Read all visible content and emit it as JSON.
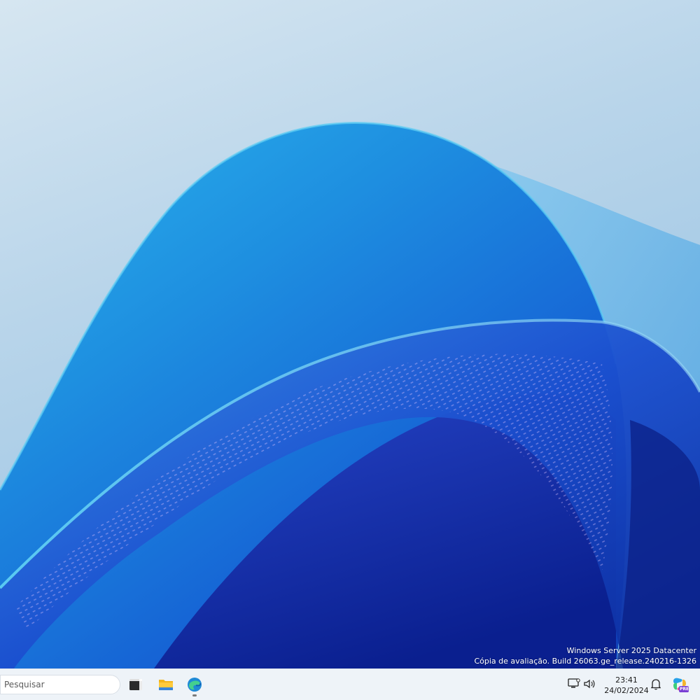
{
  "desktop": {
    "watermark": {
      "line1": "Windows Server 2025 Datacenter",
      "line2": "Cópia de avaliação. Build 26063.ge_release.240216-1326"
    }
  },
  "taskbar": {
    "search": {
      "placeholder": "Pesquisar"
    },
    "pinned": [
      {
        "name": "terminal",
        "icon": "terminal-icon"
      },
      {
        "name": "file-explorer",
        "icon": "folder-icon"
      },
      {
        "name": "edge",
        "icon": "edge-icon"
      }
    ],
    "tray": {
      "icons": [
        "network-icon",
        "volume-icon",
        "notification-bell-icon",
        "copilot-icon"
      ],
      "copilot_badge": "PRE",
      "time": "23:41",
      "date": "24/02/2024"
    }
  },
  "colors": {
    "taskbar_bg": "#eef3f8",
    "accent": "#0a64d6"
  }
}
